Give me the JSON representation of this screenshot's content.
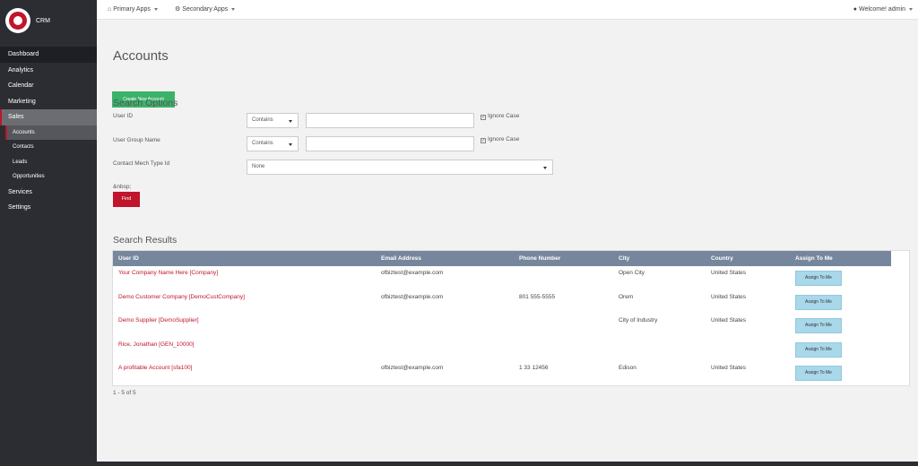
{
  "brand": {
    "name": "CRM"
  },
  "sidebar": {
    "items": [
      {
        "label": "Dashboard"
      },
      {
        "label": "Analytics"
      },
      {
        "label": "Calendar"
      },
      {
        "label": "Marketing"
      },
      {
        "label": "Sales"
      },
      {
        "label": "Services"
      },
      {
        "label": "Settings"
      }
    ],
    "sales_sub": [
      {
        "label": "Accounts"
      },
      {
        "label": "Contacts"
      },
      {
        "label": "Leads"
      },
      {
        "label": "Opportunities"
      }
    ]
  },
  "topbar": {
    "primary_apps": "Primary Apps",
    "secondary_apps": "Secondary Apps",
    "welcome": "Welcome! admin"
  },
  "page": {
    "title": "Accounts",
    "create_button": "Create New Account"
  },
  "search": {
    "title": "Search Options",
    "user_id_label": "User ID",
    "user_id_op": "Contains",
    "user_id_value": "",
    "user_id_ignore_case": "Ignore Case",
    "group_label": "User Group Name",
    "group_op": "Contains",
    "group_value": "",
    "group_ignore_case": "Ignore Case",
    "contact_mech_label": "Contact Mech Type Id",
    "contact_mech_value": "None",
    "nbsp_label": "&nbsp;",
    "find_button": "Find"
  },
  "results": {
    "title": "Search Results",
    "headers": [
      "User ID",
      "Email Address",
      "Phone Number",
      "City",
      "Country",
      "Assign To Me"
    ],
    "rows": [
      {
        "user_id": "Your Company Name Here [Company]",
        "email": "ofbiztest@example.com",
        "phone": "",
        "city": "Open City",
        "country": "United States",
        "assign": "Assign To Me"
      },
      {
        "user_id": "Demo Customer Company [DemoCustCompany]",
        "email": "ofbiztest@example.com",
        "phone": "801 555-5555",
        "city": "Orem",
        "country": "United States",
        "assign": "Assign To Me"
      },
      {
        "user_id": "Demo Supplier [DemoSupplier]",
        "email": "",
        "phone": "",
        "city": "City of Industry",
        "country": "United States",
        "assign": "Assign To Me"
      },
      {
        "user_id": "Rice, Jonathan [GEN_10000]",
        "email": "",
        "phone": "",
        "city": "",
        "country": "",
        "assign": "Assign To Me"
      },
      {
        "user_id": "A profitable Account [sfa100]",
        "email": "ofbiztest@example.com",
        "phone": "1 33 12456",
        "city": "Edison",
        "country": "United States",
        "assign": "Assign To Me"
      }
    ],
    "pager": "1 - 5 of 5"
  },
  "colors": {
    "sidebar": "#2b2d33",
    "accent_red": "#c0152b",
    "create_green": "#3bb26a",
    "table_header": "#76869c",
    "assign_blue": "#a8d8ea"
  }
}
